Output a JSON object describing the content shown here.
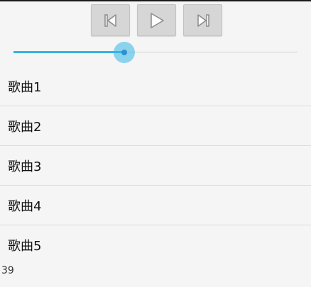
{
  "player": {
    "controls": [
      {
        "name": "previous",
        "icon": "skip-previous-icon"
      },
      {
        "name": "play",
        "icon": "play-icon"
      },
      {
        "name": "next",
        "icon": "skip-next-icon"
      }
    ],
    "progress_fraction": 0.39,
    "accent_color": "#33b5e5"
  },
  "playlist": {
    "items": [
      "歌曲1",
      "歌曲2",
      "歌曲3",
      "歌曲4",
      "歌曲5"
    ]
  },
  "status": {
    "progress_value": "39"
  }
}
